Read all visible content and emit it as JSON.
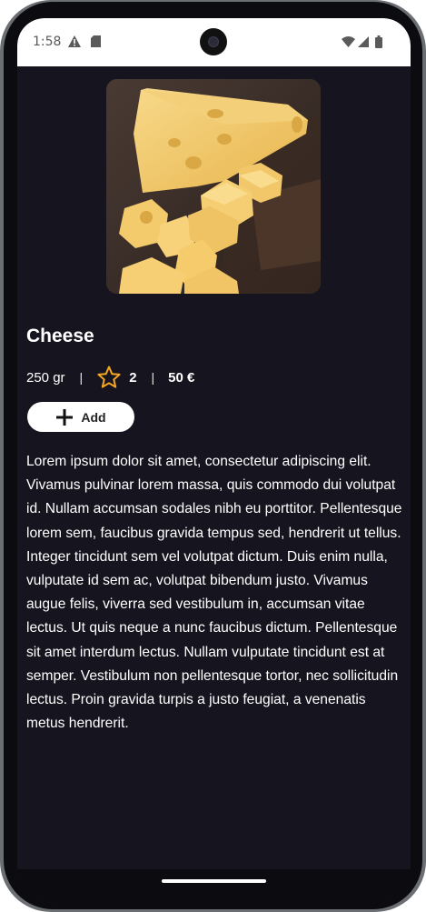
{
  "status_bar": {
    "time": "1:58",
    "left_icons": [
      "warning-icon",
      "sd-card-icon"
    ],
    "right_icons": [
      "wifi-icon",
      "signal-icon",
      "battery-icon"
    ]
  },
  "product": {
    "image_alt": "cheese-photo",
    "title": "Cheese",
    "weight": "250 gr",
    "separator": "|",
    "rating": "2",
    "price": "50 €",
    "add_label": "Add",
    "description": "Lorem ipsum dolor sit amet, consectetur adipiscing elit. Vivamus pulvinar lorem massa, quis commodo dui volutpat id. Nullam accumsan sodales nibh eu porttitor. Pellentesque lorem sem, faucibus gravida tempus sed, hendrerit ut tellus. Integer tincidunt sem vel volutpat dictum. Duis enim nulla, vulputate id sem ac, volutpat bibendum justo. Vivamus augue felis, viverra sed vestibulum in, accumsan vitae lectus. Ut quis neque a nunc faucibus dictum. Pellentesque sit amet interdum lectus. Nullam vulputate tincidunt est at semper. Vestibulum non pellentesque tortor, nec sollicitudin lectus. Proin gravida turpis a justo feugiat, a venenatis metus hendrerit."
  },
  "colors": {
    "background": "#16151f",
    "accent_star": "#f5a623",
    "text": "#ffffff",
    "button_bg": "#ffffff"
  }
}
